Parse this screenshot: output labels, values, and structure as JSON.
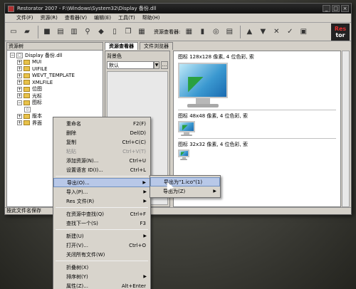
{
  "window": {
    "title": "Restorator 2007 - F:\\Windows\\System32\\Display 备份.dll",
    "min": "_",
    "max": "□",
    "close": "×"
  },
  "menubar": [
    "文件(F)",
    "资源(R)",
    "查看器(V)",
    "编辑(E)",
    "工具(T)",
    "帮助(H)"
  ],
  "toolbar": {
    "viewer_label": "资源查看器:",
    "logo_top": "Res",
    "logo_bottom": "tor"
  },
  "left_pane": {
    "header": "资源树",
    "tree": [
      {
        "label": "Display 备份.dll",
        "level": 0,
        "expander": "−",
        "icon": "dll-icon"
      },
      {
        "label": "MUI",
        "level": 1,
        "expander": "+",
        "icon": "folder-icon"
      },
      {
        "label": "UIFILE",
        "level": 1,
        "expander": "+",
        "icon": "folder-icon"
      },
      {
        "label": "WEVT_TEMPLATE",
        "level": 1,
        "expander": "+",
        "icon": "folder-icon"
      },
      {
        "label": "XMLFILE",
        "level": 1,
        "expander": "+",
        "icon": "folder-icon"
      },
      {
        "label": "位图",
        "level": 1,
        "expander": "+",
        "icon": "folder-icon"
      },
      {
        "label": "光标",
        "level": 1,
        "expander": "+",
        "icon": "folder-icon"
      },
      {
        "label": "图标",
        "level": 1,
        "expander": "−",
        "icon": "folder-icon"
      },
      {
        "label": "",
        "level": 2,
        "expander": "",
        "icon": "doc-icon"
      },
      {
        "label": "版本",
        "level": 1,
        "expander": "+",
        "icon": "folder-icon"
      },
      {
        "label": "界面",
        "level": 1,
        "expander": "+",
        "icon": "folder-icon"
      }
    ]
  },
  "tabs": [
    "资源查看器",
    "文件浏览器"
  ],
  "bg_panel": {
    "label": "背景色",
    "value": "默认",
    "dots": "..."
  },
  "preview": {
    "labels": [
      "图标 128x128 像素, 4 位色彩, 索",
      "图标 48x48 像素, 4 位色彩, 索",
      "图标 32x32 像素, 4 位色彩, 索"
    ]
  },
  "statusbar": "按此文件名保存",
  "context_menu": {
    "items": [
      {
        "label": "重命名",
        "shortcut": "F2(F)",
        "disabled": false,
        "submenu": false
      },
      {
        "label": "删除",
        "shortcut": "Del(D)",
        "disabled": false,
        "submenu": false
      },
      {
        "label": "复制",
        "shortcut": "Ctrl+C(C)",
        "disabled": false,
        "submenu": false
      },
      {
        "label": "粘贴",
        "shortcut": "Ctrl+V(T)",
        "disabled": true,
        "submenu": false
      },
      {
        "label": "添加资源(N)...",
        "shortcut": "Ctrl+U",
        "disabled": false,
        "submenu": false
      },
      {
        "label": "设置语言 ID(I)...",
        "shortcut": "Ctrl+L",
        "disabled": false,
        "submenu": false
      },
      {
        "sep": true
      },
      {
        "label": "导出(O)...",
        "shortcut": "",
        "disabled": false,
        "submenu": true,
        "highlight": true
      },
      {
        "label": "导入(P)...",
        "shortcut": "",
        "disabled": false,
        "submenu": true
      },
      {
        "label": "Res 文件(R)",
        "shortcut": "",
        "disabled": false,
        "submenu": true
      },
      {
        "sep": true
      },
      {
        "label": "在资源中查找(Q)",
        "shortcut": "Ctrl+F",
        "disabled": false,
        "submenu": false
      },
      {
        "label": "查找下一个(S)",
        "shortcut": "F3",
        "disabled": false,
        "submenu": false
      },
      {
        "sep": true
      },
      {
        "label": "新建(U)",
        "shortcut": "",
        "disabled": false,
        "submenu": true
      },
      {
        "label": "打开(V)...",
        "shortcut": "Ctrl+O",
        "disabled": false,
        "submenu": false
      },
      {
        "label": "关闭所有文件(W)",
        "shortcut": "",
        "disabled": false,
        "submenu": false
      },
      {
        "sep": true
      },
      {
        "label": "折叠树(X)",
        "shortcut": "",
        "disabled": false,
        "submenu": false
      },
      {
        "label": "排序树(Y)",
        "shortcut": "",
        "disabled": false,
        "submenu": true
      },
      {
        "label": "属性(Z)...",
        "shortcut": "Alt+Enter",
        "disabled": false,
        "submenu": false
      }
    ]
  },
  "sub_menu": {
    "items": [
      {
        "label": "导出为\"1.ico\"(1)",
        "highlight": true
      },
      {
        "label": "导出为(Z)",
        "submenu": true
      }
    ]
  }
}
